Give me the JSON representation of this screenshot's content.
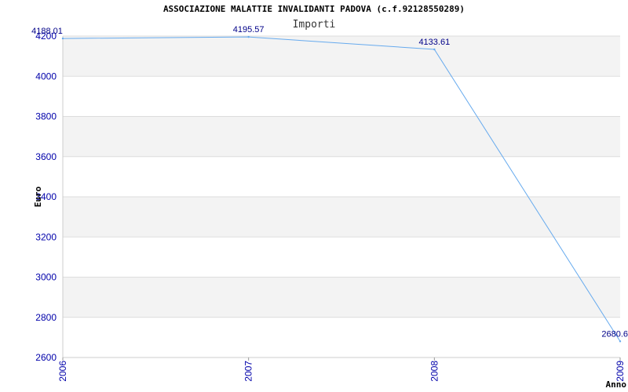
{
  "chart_data": {
    "type": "line",
    "title": "ASSOCIAZIONE MALATTIE INVALIDANTI PADOVA (c.f.92128550289)",
    "subtitle": "Importi",
    "xlabel": "Anno",
    "ylabel": "Euro",
    "categories": [
      "2006",
      "2007",
      "2008",
      "2009"
    ],
    "series": [
      {
        "values": [
          4188.01,
          4195.57,
          4133.61,
          2680.6
        ]
      }
    ],
    "data_labels": [
      "4188.01",
      "4195.57",
      "4133.61",
      "2680.6"
    ],
    "ylim": [
      2600,
      4200
    ],
    "yticks": [
      2600,
      2800,
      3000,
      3200,
      3400,
      3600,
      3800,
      4000,
      4200
    ],
    "grid": true,
    "line_color": "#66aaee",
    "band_color": "#f3f3f3",
    "tick_color": "#0000aa"
  }
}
